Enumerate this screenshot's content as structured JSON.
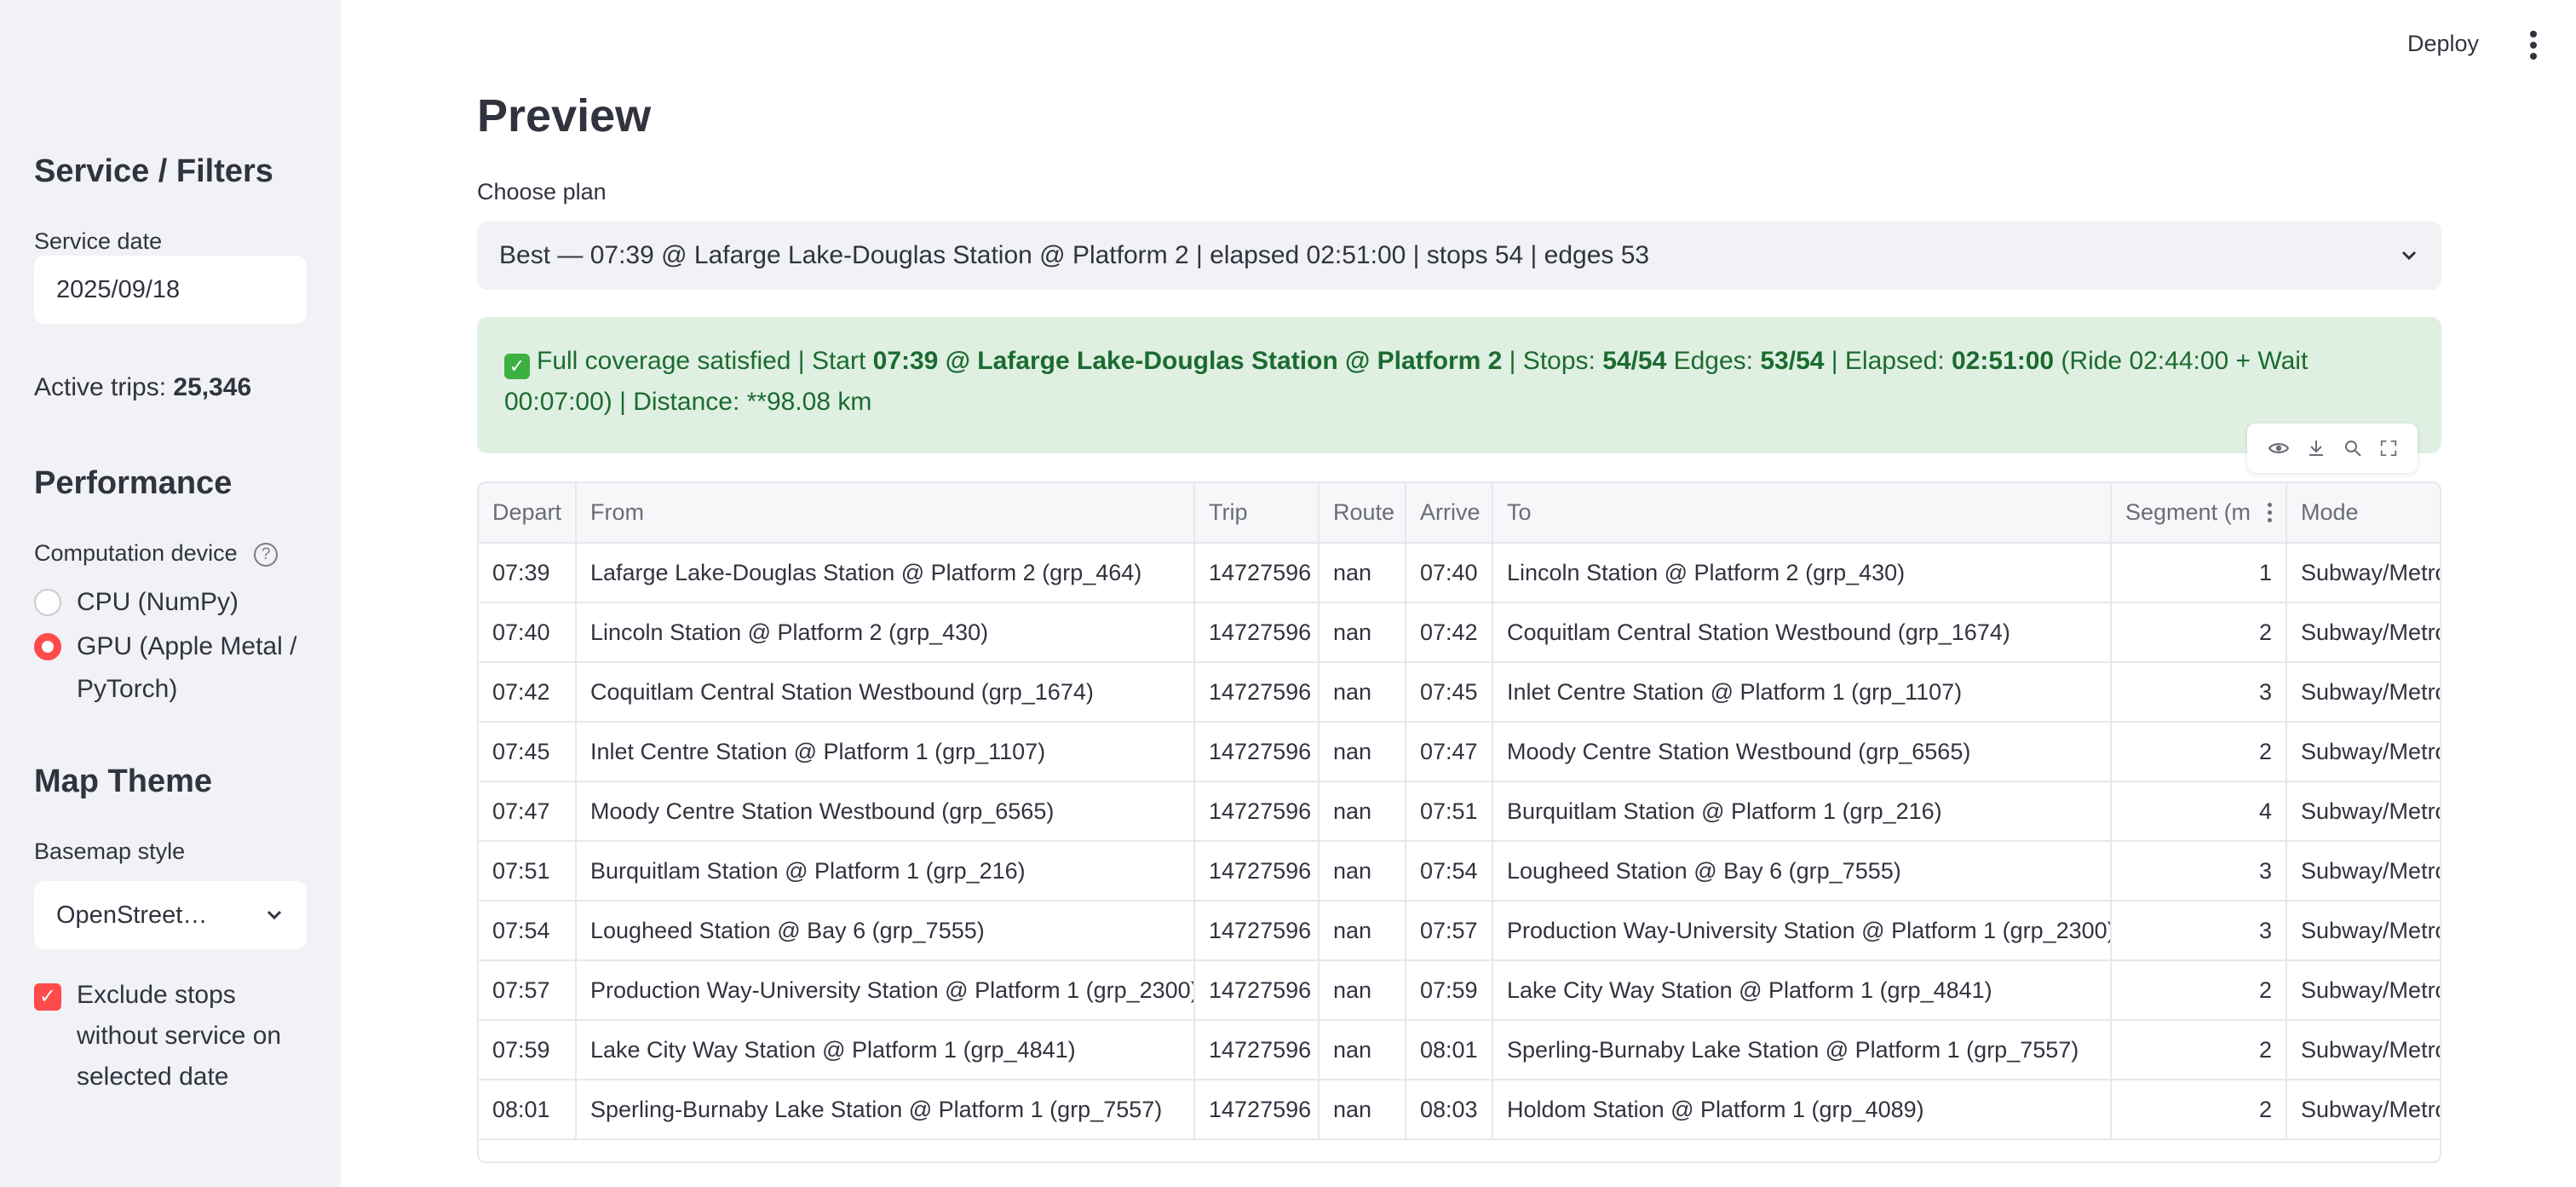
{
  "header": {
    "deploy_label": "Deploy"
  },
  "sidebar": {
    "service_heading": "Service / Filters",
    "service_date_label": "Service date",
    "service_date_value": "2025/09/18",
    "active_trips_label": "Active trips:",
    "active_trips_value": "25,346",
    "performance_heading": "Performance",
    "computation_device_label": "Computation device",
    "device_options": [
      {
        "label": "CPU (NumPy)",
        "selected": false
      },
      {
        "label": "GPU (Apple Metal / PyTorch)",
        "selected": true
      }
    ],
    "map_theme_heading": "Map Theme",
    "basemap_label": "Basemap style",
    "basemap_value": "OpenStreet…",
    "exclude_stops_label": "Exclude stops without service on selected date",
    "exclude_stops_checked": true
  },
  "main": {
    "title": "Preview",
    "choose_plan_label": "Choose plan",
    "plan_selected": "Best — 07:39 @ Lafarge Lake-Douglas Station @ Platform 2 | elapsed 02:51:00 | stops 54 | edges 53",
    "summary": {
      "part1": "Full coverage satisfied | Start ",
      "start": "07:39 @ Lafarge Lake-Douglas Station @ Platform 2",
      "part2": " | Stops: ",
      "stops": "54/54",
      "part3": " Edges: ",
      "edges": "53/54",
      "part4": " | Elapsed: ",
      "elapsed": "02:51:00",
      "part5": " (Ride 02:44:00 + Wait 00:07:00) | Distance: **98.08 km"
    },
    "table": {
      "columns": [
        "Depart",
        "From",
        "Trip",
        "Route",
        "Arrive",
        "To",
        "Segment (m",
        "Mode"
      ],
      "rows": [
        [
          "07:39",
          "Lafarge Lake-Douglas Station @ Platform 2 (grp_464)",
          "14727596",
          "nan",
          "07:40",
          "Lincoln Station @ Platform 2 (grp_430)",
          "1",
          "Subway/Metro"
        ],
        [
          "07:40",
          "Lincoln Station @ Platform 2 (grp_430)",
          "14727596",
          "nan",
          "07:42",
          "Coquitlam Central Station Westbound (grp_1674)",
          "2",
          "Subway/Metro"
        ],
        [
          "07:42",
          "Coquitlam Central Station Westbound (grp_1674)",
          "14727596",
          "nan",
          "07:45",
          "Inlet Centre Station @ Platform 1 (grp_1107)",
          "3",
          "Subway/Metro"
        ],
        [
          "07:45",
          "Inlet Centre Station @ Platform 1 (grp_1107)",
          "14727596",
          "nan",
          "07:47",
          "Moody Centre Station Westbound (grp_6565)",
          "2",
          "Subway/Metro"
        ],
        [
          "07:47",
          "Moody Centre Station Westbound (grp_6565)",
          "14727596",
          "nan",
          "07:51",
          "Burquitlam Station @ Platform 1 (grp_216)",
          "4",
          "Subway/Metro"
        ],
        [
          "07:51",
          "Burquitlam Station @ Platform 1 (grp_216)",
          "14727596",
          "nan",
          "07:54",
          "Lougheed Station @ Bay 6 (grp_7555)",
          "3",
          "Subway/Metro"
        ],
        [
          "07:54",
          "Lougheed Station @ Bay 6 (grp_7555)",
          "14727596",
          "nan",
          "07:57",
          "Production Way-University Station @ Platform 1 (grp_2300)",
          "3",
          "Subway/Metro"
        ],
        [
          "07:57",
          "Production Way-University Station @ Platform 1 (grp_2300)",
          "14727596",
          "nan",
          "07:59",
          "Lake City Way Station @ Platform 1 (grp_4841)",
          "2",
          "Subway/Metro"
        ],
        [
          "07:59",
          "Lake City Way Station @ Platform 1 (grp_4841)",
          "14727596",
          "nan",
          "08:01",
          "Sperling-Burnaby Lake Station @ Platform 1 (grp_7557)",
          "2",
          "Subway/Metro"
        ],
        [
          "08:01",
          "Sperling-Burnaby Lake Station @ Platform 1 (grp_7557)",
          "14727596",
          "nan",
          "08:03",
          "Holdom Station @ Platform 1 (grp_4089)",
          "2",
          "Subway/Metro"
        ]
      ]
    }
  },
  "colors": {
    "accent": "#ff4b4b",
    "success_bg": "#dff0e2",
    "success_text": "#1b6b30",
    "sidebar_bg": "#f0f2f6"
  },
  "icons": [
    "help-icon",
    "chevron-down-icon",
    "kebab-menu-icon",
    "eye-icon",
    "download-icon",
    "search-icon",
    "fullscreen-icon",
    "checkmark-icon"
  ]
}
